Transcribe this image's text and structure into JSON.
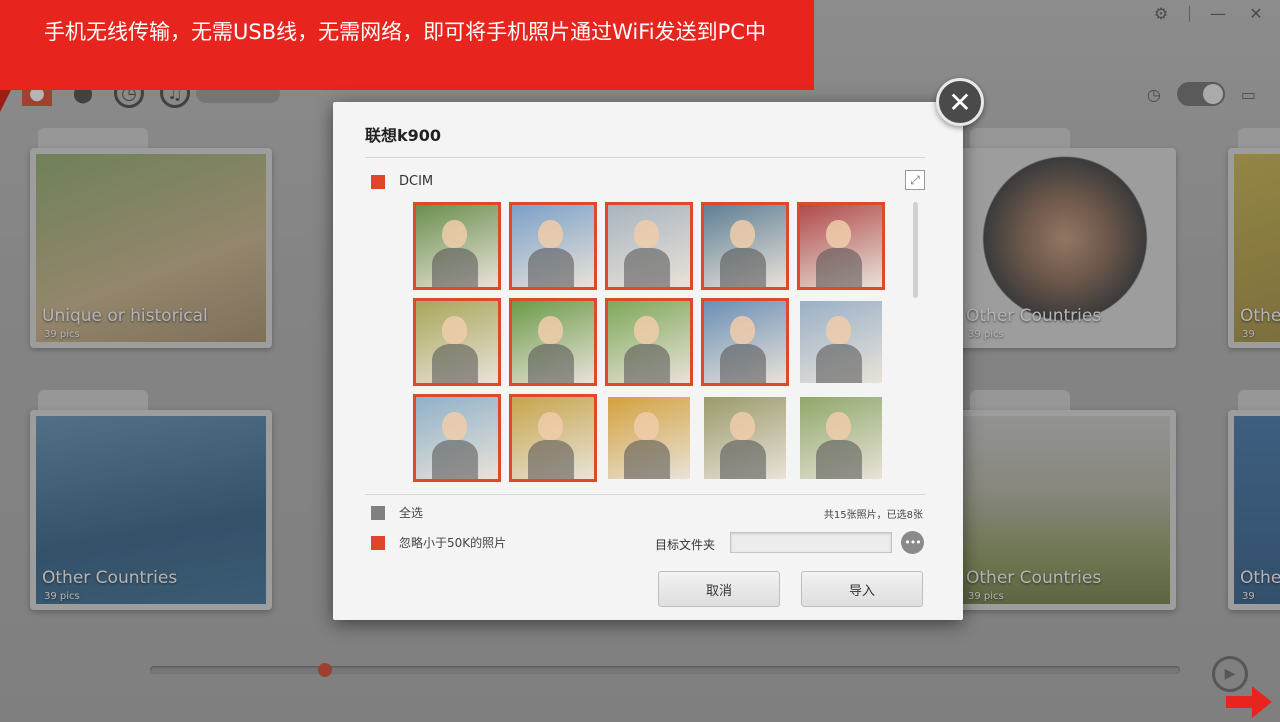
{
  "banner": {
    "text": "手机无线传输，无需USB线，无需网络，即可将手机照片通过WiFi发送到PC中"
  },
  "folders": [
    {
      "title": "Unique or historical",
      "count": "39 pics"
    },
    {
      "title": "Other Countries",
      "count": "39 pics"
    },
    {
      "title": "Other Countries",
      "count": "39 pics"
    },
    {
      "title": "Other Countries",
      "count": "39 pics"
    },
    {
      "title": "Othe",
      "count": "39"
    },
    {
      "title": "Othe",
      "count": "39"
    }
  ],
  "dialog": {
    "title": "联想k900",
    "album": "DCIM",
    "select_all": "全选",
    "count_text": "共15张照片，已选8张",
    "ignore_small": "忽略小于50K的照片",
    "target_label": "目标文件夹",
    "target_value": "",
    "browse_label": "•••",
    "cancel_label": "取消",
    "import_label": "导入",
    "close_label": "✕"
  },
  "thumbnails": [
    {
      "selected": true,
      "color": "#6a8f4e"
    },
    {
      "selected": true,
      "color": "#7ca0c8"
    },
    {
      "selected": true,
      "color": "#a9b4bf"
    },
    {
      "selected": true,
      "color": "#5f7f96"
    },
    {
      "selected": true,
      "color": "#b04a4a"
    },
    {
      "selected": true,
      "color": "#a8a65a"
    },
    {
      "selected": true,
      "color": "#6c9b4a"
    },
    {
      "selected": true,
      "color": "#7fa85a"
    },
    {
      "selected": true,
      "color": "#6b8fb5"
    },
    {
      "selected": false,
      "color": "#9ab0c7"
    },
    {
      "selected": true,
      "color": "#8fb1c9"
    },
    {
      "selected": true,
      "color": "#c7a54c"
    },
    {
      "selected": false,
      "color": "#d3a13e"
    },
    {
      "selected": false,
      "color": "#9a9a6a"
    },
    {
      "selected": false,
      "color": "#8fa86a"
    }
  ],
  "accent": "#e0452b"
}
